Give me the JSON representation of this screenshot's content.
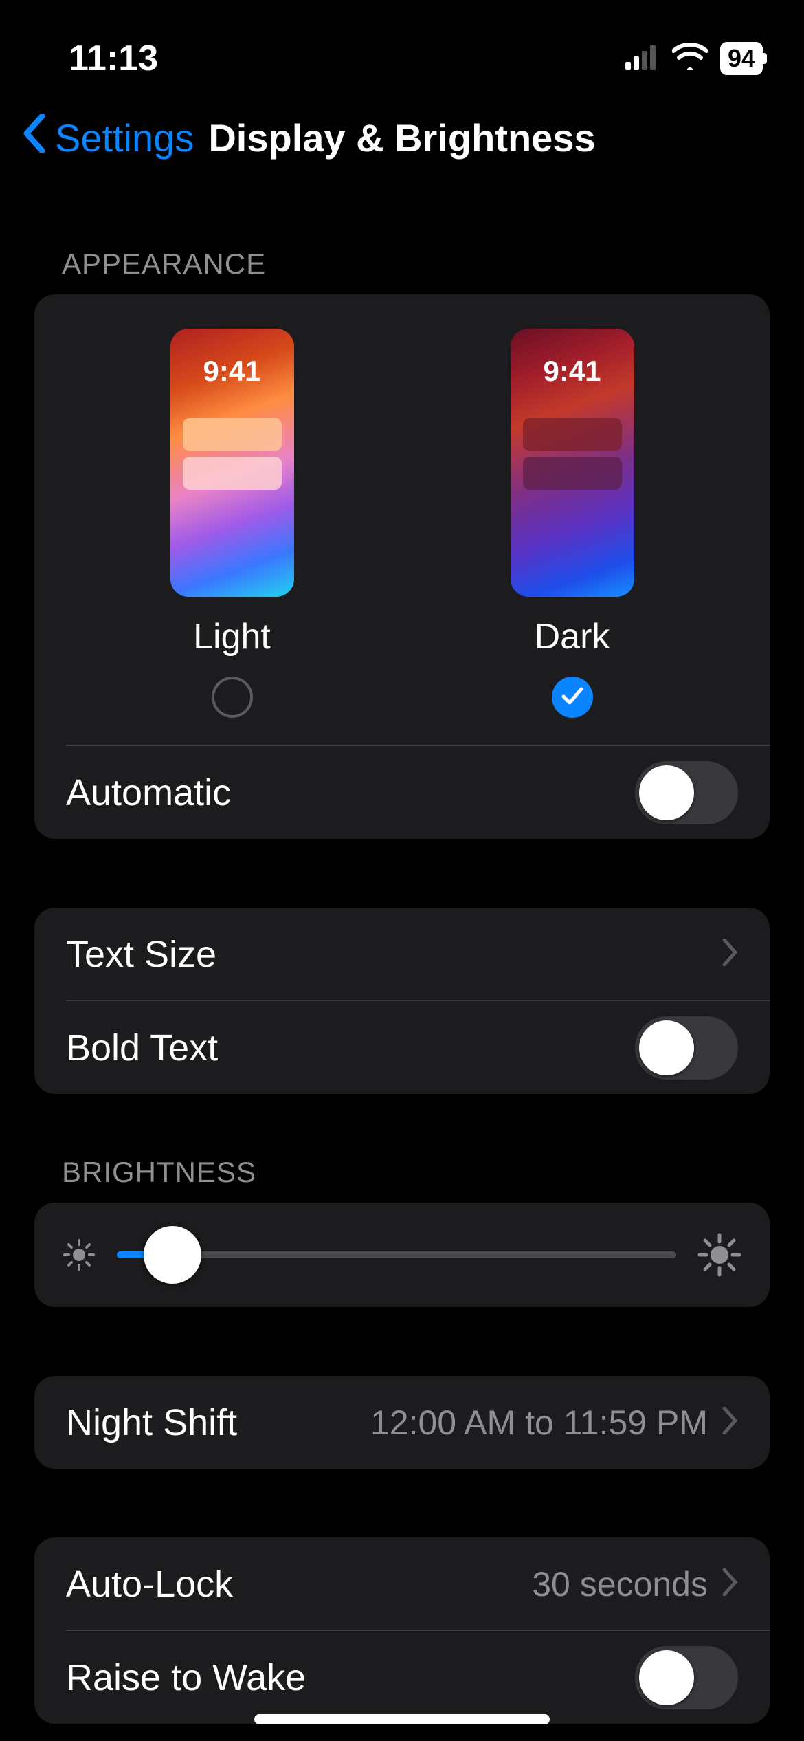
{
  "status": {
    "time": "11:13",
    "battery": "94"
  },
  "nav": {
    "back_label": "Settings",
    "title": "Display & Brightness"
  },
  "appearance": {
    "header": "Appearance",
    "preview_time": "9:41",
    "light_label": "Light",
    "dark_label": "Dark",
    "selected": "dark",
    "automatic_label": "Automatic",
    "automatic_on": false
  },
  "text": {
    "text_size_label": "Text Size",
    "bold_text_label": "Bold Text",
    "bold_text_on": false
  },
  "brightness": {
    "header": "Brightness",
    "value_percent": 10
  },
  "night_shift": {
    "label": "Night Shift",
    "detail": "12:00 AM to 11:59 PM"
  },
  "auto_lock": {
    "label": "Auto-Lock",
    "detail": "30 seconds"
  },
  "raise_to_wake": {
    "label": "Raise to Wake",
    "on": false
  }
}
